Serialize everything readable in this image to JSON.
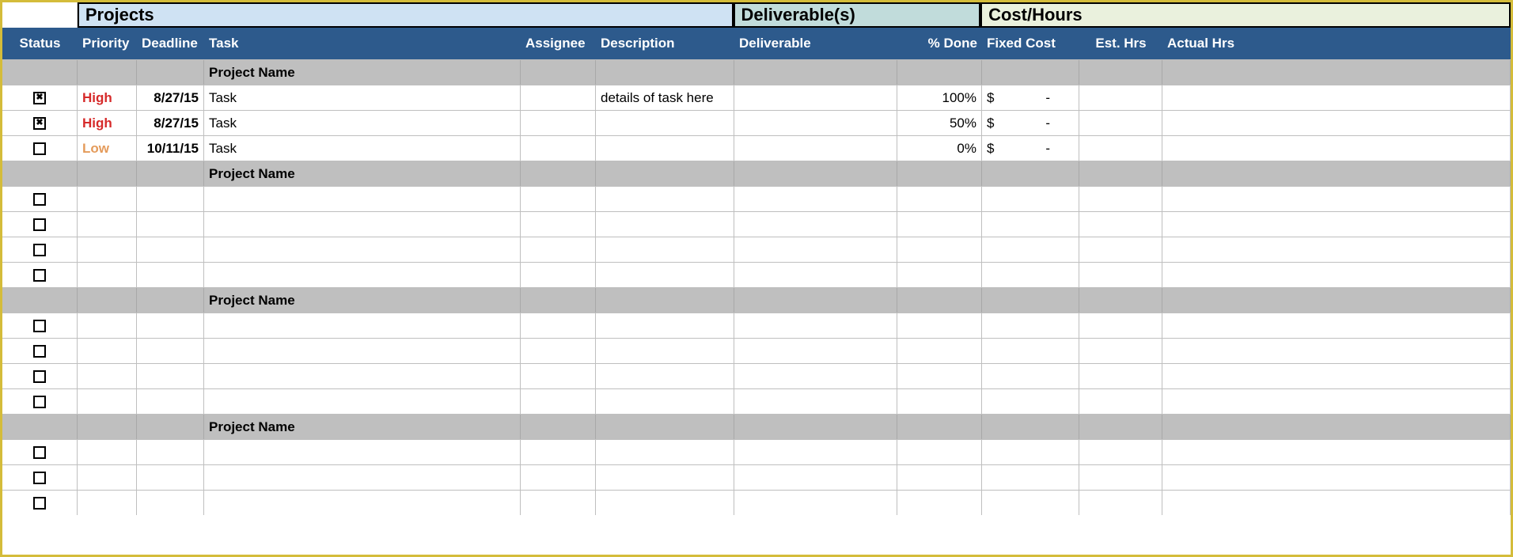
{
  "sections": {
    "projects": "Projects",
    "deliverables": "Deliverable(s)",
    "cost": "Cost/Hours"
  },
  "headers": {
    "status": "Status",
    "priority": "Priority",
    "deadline": "Deadline",
    "task": "Task",
    "assignee": "Assignee",
    "description": "Description",
    "deliverable": "Deliverable",
    "pct": "% Done",
    "fixed": "Fixed Cost",
    "est": "Est. Hrs",
    "actual": "Actual Hrs"
  },
  "groups": [
    {
      "name": "Project Name",
      "rows": [
        {
          "checked": true,
          "priority": "High",
          "pclass": "prio-high",
          "deadline": "8/27/15",
          "task": "Task",
          "assignee": "",
          "description": "details of task here",
          "deliverable": "",
          "pct": "100%",
          "fixedSym": "$",
          "fixedVal": "-",
          "est": "",
          "actual": ""
        },
        {
          "checked": true,
          "priority": "High",
          "pclass": "prio-high",
          "deadline": "8/27/15",
          "task": "Task",
          "assignee": "",
          "description": "",
          "deliverable": "",
          "pct": "50%",
          "fixedSym": "$",
          "fixedVal": "-",
          "est": "",
          "actual": ""
        },
        {
          "checked": false,
          "priority": "Low",
          "pclass": "prio-low",
          "deadline": "10/11/15",
          "task": "Task",
          "assignee": "",
          "description": "",
          "deliverable": "",
          "pct": "0%",
          "fixedSym": "$",
          "fixedVal": "-",
          "est": "",
          "actual": ""
        }
      ]
    },
    {
      "name": "Project Name",
      "rows": [
        {
          "checked": false,
          "priority": "",
          "pclass": "",
          "deadline": "",
          "task": "",
          "assignee": "",
          "description": "",
          "deliverable": "",
          "pct": "",
          "fixedSym": "",
          "fixedVal": "",
          "est": "",
          "actual": ""
        },
        {
          "checked": false,
          "priority": "",
          "pclass": "",
          "deadline": "",
          "task": "",
          "assignee": "",
          "description": "",
          "deliverable": "",
          "pct": "",
          "fixedSym": "",
          "fixedVal": "",
          "est": "",
          "actual": ""
        },
        {
          "checked": false,
          "priority": "",
          "pclass": "",
          "deadline": "",
          "task": "",
          "assignee": "",
          "description": "",
          "deliverable": "",
          "pct": "",
          "fixedSym": "",
          "fixedVal": "",
          "est": "",
          "actual": ""
        },
        {
          "checked": false,
          "priority": "",
          "pclass": "",
          "deadline": "",
          "task": "",
          "assignee": "",
          "description": "",
          "deliverable": "",
          "pct": "",
          "fixedSym": "",
          "fixedVal": "",
          "est": "",
          "actual": ""
        }
      ]
    },
    {
      "name": "Project Name",
      "rows": [
        {
          "checked": false,
          "priority": "",
          "pclass": "",
          "deadline": "",
          "task": "",
          "assignee": "",
          "description": "",
          "deliverable": "",
          "pct": "",
          "fixedSym": "",
          "fixedVal": "",
          "est": "",
          "actual": ""
        },
        {
          "checked": false,
          "priority": "",
          "pclass": "",
          "deadline": "",
          "task": "",
          "assignee": "",
          "description": "",
          "deliverable": "",
          "pct": "",
          "fixedSym": "",
          "fixedVal": "",
          "est": "",
          "actual": ""
        },
        {
          "checked": false,
          "priority": "",
          "pclass": "",
          "deadline": "",
          "task": "",
          "assignee": "",
          "description": "",
          "deliverable": "",
          "pct": "",
          "fixedSym": "",
          "fixedVal": "",
          "est": "",
          "actual": ""
        },
        {
          "checked": false,
          "priority": "",
          "pclass": "",
          "deadline": "",
          "task": "",
          "assignee": "",
          "description": "",
          "deliverable": "",
          "pct": "",
          "fixedSym": "",
          "fixedVal": "",
          "est": "",
          "actual": ""
        }
      ]
    },
    {
      "name": "Project Name",
      "rows": [
        {
          "checked": false,
          "priority": "",
          "pclass": "",
          "deadline": "",
          "task": "",
          "assignee": "",
          "description": "",
          "deliverable": "",
          "pct": "",
          "fixedSym": "",
          "fixedVal": "",
          "est": "",
          "actual": ""
        },
        {
          "checked": false,
          "priority": "",
          "pclass": "",
          "deadline": "",
          "task": "",
          "assignee": "",
          "description": "",
          "deliverable": "",
          "pct": "",
          "fixedSym": "",
          "fixedVal": "",
          "est": "",
          "actual": ""
        },
        {
          "checked": false,
          "priority": "",
          "pclass": "",
          "deadline": "",
          "task": "",
          "assignee": "",
          "description": "",
          "deliverable": "",
          "pct": "",
          "fixedSym": "",
          "fixedVal": "",
          "est": "",
          "actual": ""
        }
      ]
    }
  ]
}
